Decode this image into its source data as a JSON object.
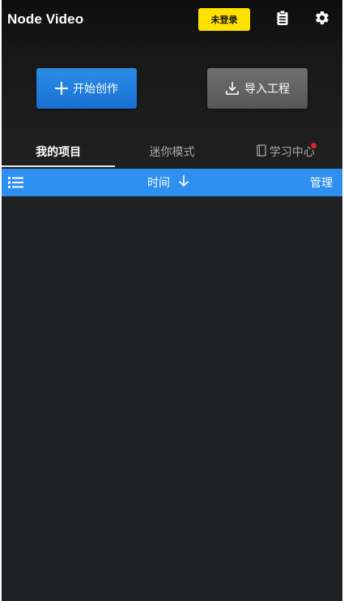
{
  "header": {
    "app_title": "Node Video",
    "login_badge": "未登录",
    "clipboard_icon": "clipboard-icon",
    "settings_icon": "gear-icon"
  },
  "actions": {
    "create_label": "开始创作",
    "import_label": "导入工程"
  },
  "tabs": [
    {
      "label": "我的项目",
      "active": true
    },
    {
      "label": "迷你模式",
      "active": false
    },
    {
      "label": "学习中心",
      "active": false,
      "has_notification": true
    }
  ],
  "sort_bar": {
    "sort_label": "时间",
    "manage_label": "管理"
  },
  "colors": {
    "accent_blue": "#2d8ff0",
    "badge_yellow": "#ffe100",
    "notification_red": "#e0261b",
    "background": "#1e2223"
  }
}
